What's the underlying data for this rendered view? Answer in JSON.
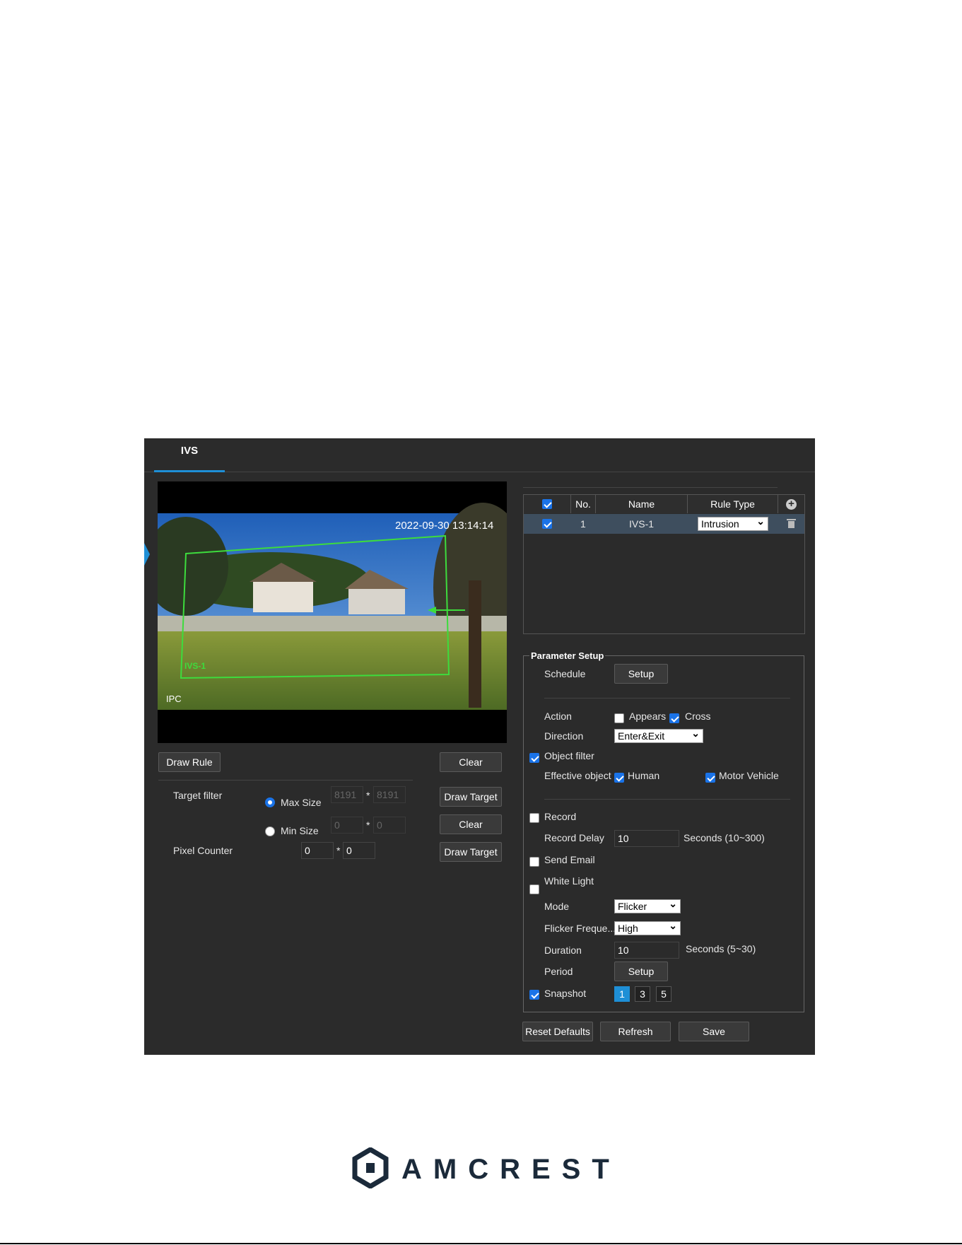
{
  "tab": {
    "label": "IVS"
  },
  "video": {
    "timestamp": "2022-09-30 13:14:14",
    "rule_label": "IVS-1",
    "channel_label": "IPC"
  },
  "left": {
    "draw_rule": "Draw Rule",
    "clear1": "Clear",
    "target_filter": "Target filter",
    "max_size": "Max Size",
    "min_size": "Min Size",
    "max_w": "8191",
    "max_h": "8191",
    "min_w": "0",
    "min_h": "0",
    "star": "*",
    "draw_target1": "Draw Target",
    "clear2": "Clear",
    "pixel_counter": "Pixel Counter",
    "px_w": "0",
    "px_h": "0",
    "draw_target2": "Draw Target"
  },
  "table": {
    "headers": {
      "no": "No.",
      "name": "Name",
      "rule_type": "Rule Type"
    },
    "rows": [
      {
        "no": "1",
        "name": "IVS-1",
        "rule_type": "Intrusion"
      }
    ]
  },
  "params": {
    "legend": "Parameter Setup",
    "schedule": "Schedule",
    "setup": "Setup",
    "action": "Action",
    "appears": "Appears",
    "cross": "Cross",
    "direction": "Direction",
    "direction_value": "Enter&Exit",
    "object_filter": "Object filter",
    "effective_object": "Effective object",
    "human": "Human",
    "motor_vehicle": "Motor Vehicle",
    "record": "Record",
    "record_delay": "Record Delay",
    "record_delay_value": "10",
    "record_delay_unit": "Seconds (10~300)",
    "send_email": "Send Email",
    "white_light": "White Light",
    "mode": "Mode",
    "mode_value": "Flicker",
    "flicker_freq": "Flicker Freque...",
    "flicker_freq_value": "High",
    "duration": "Duration",
    "duration_value": "10",
    "duration_unit": "Seconds (5~30)",
    "period": "Period",
    "period_setup": "Setup",
    "snapshot": "Snapshot",
    "snap_options": [
      "1",
      "3",
      "5"
    ]
  },
  "footer": {
    "reset": "Reset Defaults",
    "refresh": "Refresh",
    "save": "Save"
  },
  "brand": {
    "name": "AMCREST"
  },
  "colors": {
    "panel_bg": "#2b2b2b",
    "accent": "#1e8fd6",
    "detect_line": "#3ddc3d"
  }
}
